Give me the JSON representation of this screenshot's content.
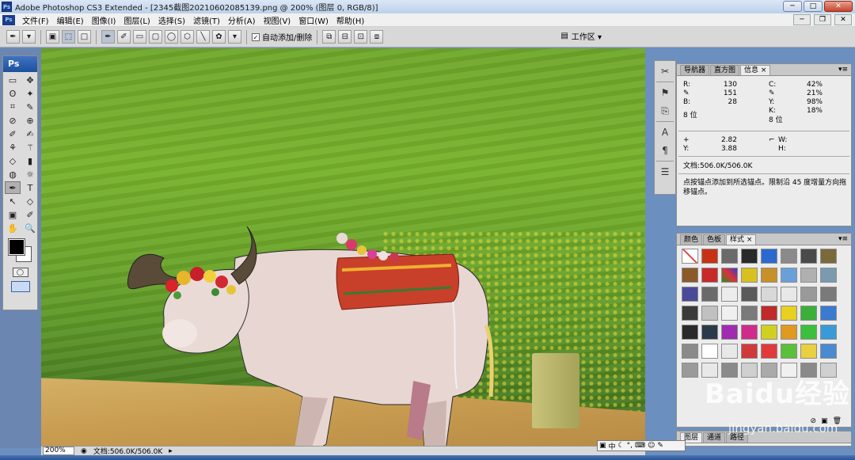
{
  "window": {
    "title": "Adobe Photoshop CS3 Extended - [2345截图20210602085139.png @ 200% (图层 0, RGB/8)]",
    "app_icon": "Ps",
    "controls": {
      "minimize": "─",
      "maximize": "□",
      "close": "✕"
    }
  },
  "menubar": {
    "logo": "Ps",
    "items": [
      "文件(F)",
      "编辑(E)",
      "图像(I)",
      "图层(L)",
      "选择(S)",
      "滤镜(T)",
      "分析(A)",
      "视图(V)",
      "窗口(W)",
      "帮助(H)"
    ],
    "doc_controls": {
      "minimize": "─",
      "restore": "❐",
      "close": "✕"
    }
  },
  "options_bar": {
    "auto_add_delete_label": "自动添加/删除",
    "auto_add_delete_checked": "✓",
    "workspace_label": "工作区 ▾"
  },
  "toolbox": {
    "logo": "Ps",
    "tools": [
      "▭",
      "✥",
      "ʘ",
      "✦",
      "⌗",
      "✎",
      "⊘",
      "⊕",
      "✐",
      "✍",
      "⚘",
      "⚚",
      "◇",
      "▮",
      "◍",
      "☼",
      "✒",
      "T",
      "↖",
      "◇",
      "▣",
      "✐",
      "✋",
      "🔍"
    ]
  },
  "status_bar": {
    "zoom": "200%",
    "doc_size": "文档:506.0K/506.0K"
  },
  "info_panel": {
    "tabs": [
      "导航器",
      "直方图",
      "信息"
    ],
    "active_tab": "信息",
    "rgb": {
      "R": "130",
      "G": "151",
      "B": "28"
    },
    "cmyk": {
      "C": "42%",
      "M": "21%",
      "Y": "98%",
      "K": "18%"
    },
    "bit_depth_left": "8 位",
    "bit_depth_right": "8 位",
    "xy": {
      "X": "2.82",
      "Y": "3.88"
    },
    "wh": {
      "W": "",
      "H": ""
    },
    "doc": "文档:506.0K/506.0K",
    "description": "点按锚点添加到所选锚点。限制沿 45 度增量方向拖移锚点。"
  },
  "swatch_panel": {
    "tabs": [
      "颜色",
      "色板",
      "样式"
    ],
    "active_tab": "样式"
  },
  "layers_panel": {
    "tabs": [
      "图层",
      "通道",
      "路径"
    ]
  },
  "ime_bar": {
    "label": "中"
  },
  "watermark": {
    "text": "Baidu经验",
    "sub": "jingyan.baidu.com"
  },
  "colors": {
    "grass": "#6fa82b",
    "path": "#c99e52",
    "foreground": "#000000",
    "background": "#ffffff"
  }
}
